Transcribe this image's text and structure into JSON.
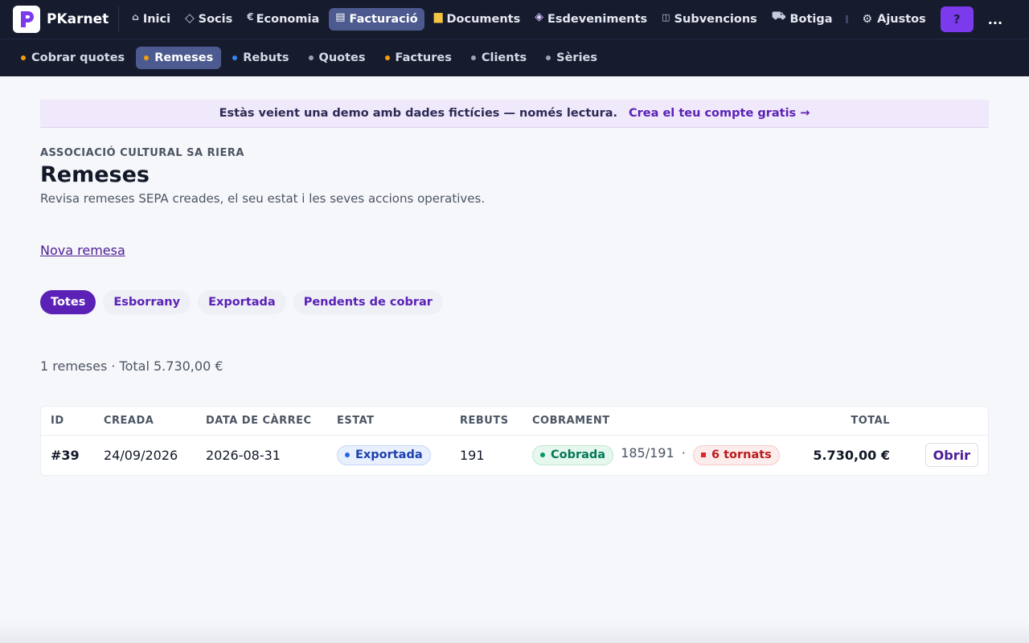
{
  "app": {
    "brand": "PKarnet"
  },
  "nav": {
    "items": [
      {
        "label": "Inici",
        "icon": "home-icon",
        "glyph": "⌂"
      },
      {
        "label": "Socis",
        "icon": "diamond-icon",
        "glyph": "◇"
      },
      {
        "label": "Economia",
        "icon": "euro-icon",
        "glyph": "€"
      },
      {
        "label": "Facturació",
        "icon": "receipt-icon",
        "glyph": "🧾",
        "active": true
      },
      {
        "label": "Documents",
        "icon": "folder-icon",
        "glyph": "🗂"
      },
      {
        "label": "Esdeveniments",
        "icon": "sparkle-diamond-icon",
        "glyph": "◈"
      },
      {
        "label": "Subvencions",
        "icon": "book-icon",
        "glyph": "◫"
      },
      {
        "label": "Botiga",
        "icon": "cart-icon",
        "glyph": "🛒"
      }
    ],
    "settings_label": "Ajustos",
    "help_label": "?",
    "more_label": "..."
  },
  "subnav": {
    "items": [
      {
        "label": "Cobrar quotes",
        "dot": "#f59e0b"
      },
      {
        "label": "Remeses",
        "dot": "#f59e0b",
        "active": true
      },
      {
        "label": "Rebuts",
        "dot": "#3b82f6"
      },
      {
        "label": "Quotes",
        "dot": "#9ca3af"
      },
      {
        "label": "Factures",
        "dot": "#f59e0b"
      },
      {
        "label": "Clients",
        "dot": "#9ca3af"
      },
      {
        "label": "Sèries",
        "dot": "#9ca3af"
      }
    ]
  },
  "banner": {
    "message": "Estàs veient una demo amb dades fictícies — només lectura.",
    "cta": "Crea el teu compte gratis →"
  },
  "page": {
    "org": "ASSOCIACIÓ CULTURAL SA RIERA",
    "title": "Remeses",
    "subtitle": "Revisa remeses SEPA creades, el seu estat i les seves accions operatives.",
    "new_link": "Nova remesa"
  },
  "filters": [
    {
      "label": "Totes",
      "active": true
    },
    {
      "label": "Esborrany"
    },
    {
      "label": "Exportada"
    },
    {
      "label": "Pendents de cobrar"
    }
  ],
  "summary": "1 remeses · Total 5.730,00 €",
  "table": {
    "headers": {
      "id": "ID",
      "created": "CREADA",
      "charge_date": "DATA DE CÀRREC",
      "status": "ESTAT",
      "receipts": "REBUTS",
      "collection": "COBRAMENT",
      "total": "TOTAL"
    },
    "rows": [
      {
        "id": "#39",
        "created": "24/09/2026",
        "charge_date": "2026-08-31",
        "status": "Exportada",
        "receipts": "191",
        "collection_status": "Cobrada",
        "collection_ratio": "185/191",
        "separator": "·",
        "returned": "6 tornats",
        "total": "5.730,00 €",
        "action": "Obrir"
      }
    ]
  },
  "colors": {
    "accent": "#5b21b6",
    "nav_bg": "#161b2e",
    "nav_active": "#4c5a8f",
    "help_button": "#7c3aed"
  }
}
